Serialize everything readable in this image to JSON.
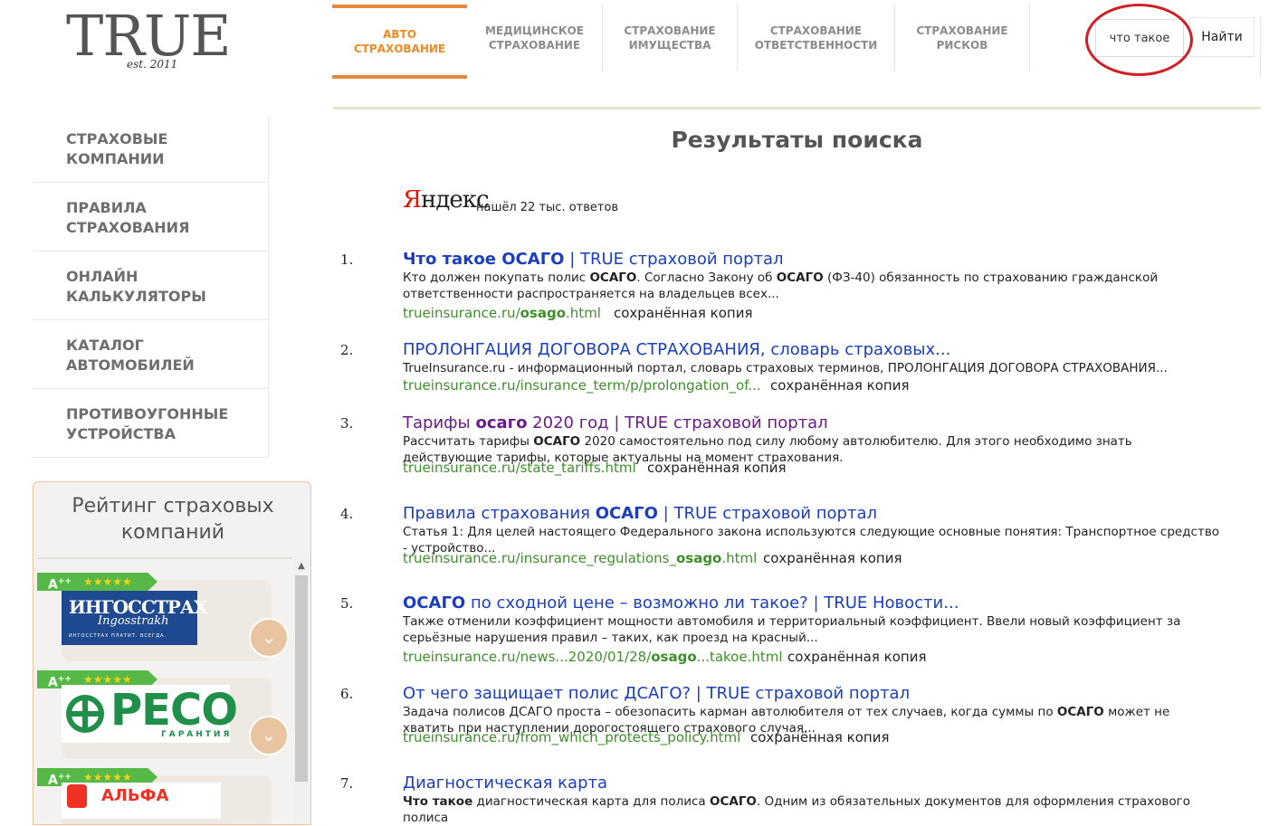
{
  "logo": {
    "text": "TRUE",
    "est": "est. 2011"
  },
  "topnav": {
    "tabs": [
      {
        "label": "Авто\nстрахование",
        "active": true
      },
      {
        "label": "Медицинское\nстрахование",
        "active": false
      },
      {
        "label": "Страхование\nимущества",
        "active": false
      },
      {
        "label": "Страхование\nответственности",
        "active": false
      },
      {
        "label": "Страхование\nрисков",
        "active": false
      }
    ]
  },
  "search": {
    "value": "что такое",
    "button": "Найти"
  },
  "sidebar": {
    "items": [
      {
        "label": "Страховые\nкомпании"
      },
      {
        "label": "Правила\nстрахования"
      },
      {
        "label": "Онлайн\nкалькуляторы"
      },
      {
        "label": "Каталог\nавтомобилей"
      },
      {
        "label": "Противоугонные\nустройства"
      }
    ]
  },
  "rating": {
    "title": "Рейтинг страховых\nкомпаний",
    "companies": [
      {
        "grade": "A",
        "grade_sup": "++",
        "stars": "★★★★★",
        "logo_line1": "ИНГОССТРАХ",
        "logo_line2": "Ingosstrakh",
        "logo_line3": "ИНГОССТРАХ ПЛАТИТ. ВСЕГДА."
      },
      {
        "grade": "A",
        "grade_sup": "++",
        "stars": "★★★★★",
        "logo_line1": "РЕСО",
        "logo_line2": "ГАРАНТИЯ"
      },
      {
        "grade": "A",
        "grade_sup": "++",
        "stars": "★★★★★",
        "logo_line1": "АЛЬФА"
      }
    ]
  },
  "main": {
    "title": "Результаты поиска",
    "yandex": {
      "logo_first": "Я",
      "logo_rest": "ндекс",
      "found": "нашёл 22 тыс. ответов"
    },
    "results": [
      {
        "num": "1.",
        "title_parts": [
          {
            "text": "Что такое ОСАГО",
            "b": true
          },
          {
            "text": " | TRUE страховой портал",
            "b": false
          }
        ],
        "visited": false,
        "snippet_parts": [
          {
            "text": "Кто должен покупать полис ",
            "b": false
          },
          {
            "text": "ОСАГО",
            "b": true
          },
          {
            "text": ". Согласно Закону об ",
            "b": false
          },
          {
            "text": "ОСАГО",
            "b": true
          },
          {
            "text": " (ФЗ-40) обязанность по страхованию гражданской ответственности распространяется на владельцев всех...",
            "b": false
          }
        ],
        "url_parts": [
          {
            "text": "trueinsurance.ru/",
            "b": false
          },
          {
            "text": "osago",
            "b": true
          },
          {
            "text": ".html",
            "b": false
          }
        ],
        "cache": "сохранённая копия"
      },
      {
        "num": "2.",
        "title_parts": [
          {
            "text": "ПРОЛОНГАЦИЯ ДОГОВОРА СТРАХОВАНИЯ, словарь страховых...",
            "b": false
          }
        ],
        "visited": false,
        "snippet_parts": [
          {
            "text": "TrueInsurance.ru - информационный портал, словарь страховых терминов, ПРОЛОНГАЦИЯ ДОГОВОРА СТРАХОВАНИЯ...",
            "b": false
          }
        ],
        "url_parts": [
          {
            "text": "trueinsurance.ru/insurance_term/p/prolongation_of...",
            "b": false
          }
        ],
        "cache": "сохранённая копия"
      },
      {
        "num": "3.",
        "title_parts": [
          {
            "text": "Тарифы ",
            "b": false
          },
          {
            "text": "осаго",
            "b": true
          },
          {
            "text": " 2020 год | TRUE страховой портал",
            "b": false
          }
        ],
        "visited": true,
        "snippet_parts": [
          {
            "text": "Рассчитать тарифы ",
            "b": false
          },
          {
            "text": "ОСАГО",
            "b": true
          },
          {
            "text": " 2020 самостоятельно под силу любому автолюбителю. Для этого необходимо знать действующие тарифы, которые актуальны на момент страхования.",
            "b": false
          }
        ],
        "url_parts": [
          {
            "text": "trueinsurance.ru/state_tariffs.html",
            "b": false
          }
        ],
        "cache": "сохранённая копия"
      },
      {
        "num": "4.",
        "title_parts": [
          {
            "text": "Правила страхования ",
            "b": false
          },
          {
            "text": "ОСАГО",
            "b": true
          },
          {
            "text": " | TRUE страховой портал",
            "b": false
          }
        ],
        "visited": false,
        "snippet_parts": [
          {
            "text": "Статья 1: Для целей настоящего Федерального закона используются следующие основные понятия: Транспортное средство - устройство...",
            "b": false
          }
        ],
        "url_parts": [
          {
            "text": "trueinsurance.ru/insurance_regulations_",
            "b": false
          },
          {
            "text": "osago",
            "b": true
          },
          {
            "text": ".html",
            "b": false
          }
        ],
        "cache": "сохранённая копия"
      },
      {
        "num": "5.",
        "title_parts": [
          {
            "text": "ОСАГО",
            "b": true
          },
          {
            "text": " по сходной цене – возможно ли такое? | TRUE Новости...",
            "b": false
          }
        ],
        "visited": false,
        "snippet_parts": [
          {
            "text": "Также отменили коэффициент мощности автомобиля и территориальный коэффициент. Ввели новый коэффициент за серьёзные нарушения правил – таких, как проезд на красный...",
            "b": false
          }
        ],
        "url_parts": [
          {
            "text": "trueinsurance.ru/news...2020/01/28/",
            "b": false
          },
          {
            "text": "osago",
            "b": true
          },
          {
            "text": "...takoe.html",
            "b": false
          }
        ],
        "cache": "сохранённая копия"
      },
      {
        "num": "6.",
        "title_parts": [
          {
            "text": "От чего защищает полис ДСАГО? | TRUE страховой портал",
            "b": false
          }
        ],
        "visited": false,
        "snippet_parts": [
          {
            "text": "Задача полисов ДСАГО проста – обезопасить карман автолюбителя от тех случаев, когда суммы по ",
            "b": false
          },
          {
            "text": "ОСАГО",
            "b": true
          },
          {
            "text": " может не хватить при наступлении дорогостоящего страхового случая...",
            "b": false
          }
        ],
        "url_parts": [
          {
            "text": "trueinsurance.ru/from_which_protects_policy.html",
            "b": false
          }
        ],
        "cache": "сохранённая копия"
      },
      {
        "num": "7.",
        "title_parts": [
          {
            "text": "Диагностическая карта",
            "b": false
          }
        ],
        "visited": false,
        "snippet_parts": [
          {
            "text": "Что такое",
            "b": true
          },
          {
            "text": " диагностическая карта для полиса ",
            "b": false
          },
          {
            "text": "ОСАГО",
            "b": true
          },
          {
            "text": ". Одним из обязательных документов для оформления страхового полиса",
            "b": false
          }
        ],
        "url_parts": [],
        "cache": ""
      }
    ]
  },
  "colors": {
    "accent": "#e5883a",
    "link": "#1a3dc1",
    "visited": "#6a1b8a",
    "url": "#3d8f2a",
    "highlight": "#d21f26",
    "badge": "#56b947"
  }
}
